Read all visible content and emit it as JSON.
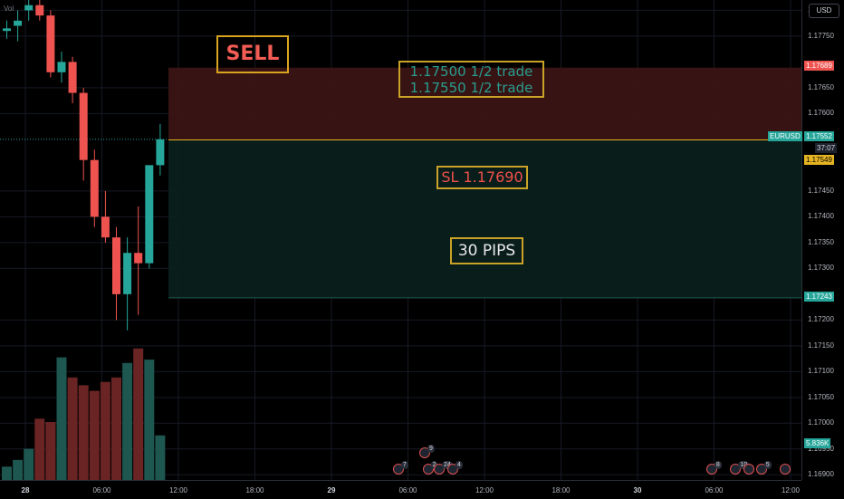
{
  "symbol": "EURUSD",
  "currency_button": "USD",
  "volume_label": "Vol",
  "annotations": {
    "sell": "SELL",
    "tp_line1": "1.17500 1/2 trade",
    "tp_line2": "1.17550 1/2 trade",
    "sl": "SL 1.17690",
    "pips": "30 PIPS"
  },
  "price_axis": {
    "ticks": [
      "1.17800",
      "1.17750",
      "1.17650",
      "1.17600",
      "1.17450",
      "1.17400",
      "1.17350",
      "1.17300",
      "1.17200",
      "1.17150",
      "1.17100",
      "1.17050",
      "1.17000",
      "1.16950",
      "1.16900"
    ],
    "tags": {
      "stop": "1.17689",
      "symbol": "EURUSD",
      "price": "1.17552",
      "countdown": "37:07",
      "entry": "1.17549",
      "target": "1.17243",
      "volume": "5.836K"
    }
  },
  "time_axis": [
    "28",
    "06:00",
    "12:00",
    "18:00",
    "29",
    "06:00",
    "12:00",
    "18:00",
    "30",
    "06:00",
    "12:00"
  ],
  "colors": {
    "up": "#26a69a",
    "down": "#ef5350",
    "stop_zone": "#3a1414",
    "target_zone": "#0a1f1c",
    "price_line": "#e6b422"
  },
  "chart_data": {
    "type": "candlestick",
    "ylim": [
      1.1689,
      1.1782
    ],
    "candles": [
      {
        "o": 1.1776,
        "h": 1.1778,
        "l": 1.17745,
        "c": 1.17765
      },
      {
        "o": 1.1777,
        "h": 1.178,
        "l": 1.1774,
        "c": 1.1778
      },
      {
        "o": 1.178,
        "h": 1.1783,
        "l": 1.1778,
        "c": 1.1781
      },
      {
        "o": 1.1781,
        "h": 1.1783,
        "l": 1.1778,
        "c": 1.1779
      },
      {
        "o": 1.1779,
        "h": 1.178,
        "l": 1.1767,
        "c": 1.1768
      },
      {
        "o": 1.1768,
        "h": 1.1772,
        "l": 1.1766,
        "c": 1.177
      },
      {
        "o": 1.177,
        "h": 1.1771,
        "l": 1.1762,
        "c": 1.1764
      },
      {
        "o": 1.1764,
        "h": 1.1765,
        "l": 1.1747,
        "c": 1.1751
      },
      {
        "o": 1.1751,
        "h": 1.1753,
        "l": 1.1738,
        "c": 1.174
      },
      {
        "o": 1.174,
        "h": 1.1745,
        "l": 1.1735,
        "c": 1.1736
      },
      {
        "o": 1.1736,
        "h": 1.1738,
        "l": 1.172,
        "c": 1.1725
      },
      {
        "o": 1.1725,
        "h": 1.1736,
        "l": 1.1718,
        "c": 1.1733
      },
      {
        "o": 1.1733,
        "h": 1.1742,
        "l": 1.1721,
        "c": 1.1731
      },
      {
        "o": 1.1731,
        "h": 1.1747,
        "l": 1.173,
        "c": 1.175
      },
      {
        "o": 1.175,
        "h": 1.1758,
        "l": 1.1748,
        "c": 1.1755
      }
    ],
    "volume": [
      12,
      18,
      28,
      55,
      52,
      110,
      92,
      85,
      80,
      88,
      92,
      105,
      118,
      108,
      40
    ],
    "volume_max": 130,
    "position": {
      "entry": 1.17549,
      "stop": 1.17689,
      "target": 1.17243
    },
    "events": [
      {
        "t": 0.497,
        "label": "7"
      },
      {
        "t": 0.53,
        "label": "9"
      },
      {
        "t": 0.534,
        "label": "2"
      },
      {
        "t": 0.548,
        "label": "24"
      },
      {
        "t": 0.565,
        "label": "4"
      },
      {
        "t": 0.888,
        "label": "8"
      },
      {
        "t": 0.918,
        "label": "10"
      },
      {
        "t": 0.935,
        "label": ""
      },
      {
        "t": 0.95,
        "label": "5"
      },
      {
        "t": 0.98,
        "label": ""
      }
    ]
  }
}
